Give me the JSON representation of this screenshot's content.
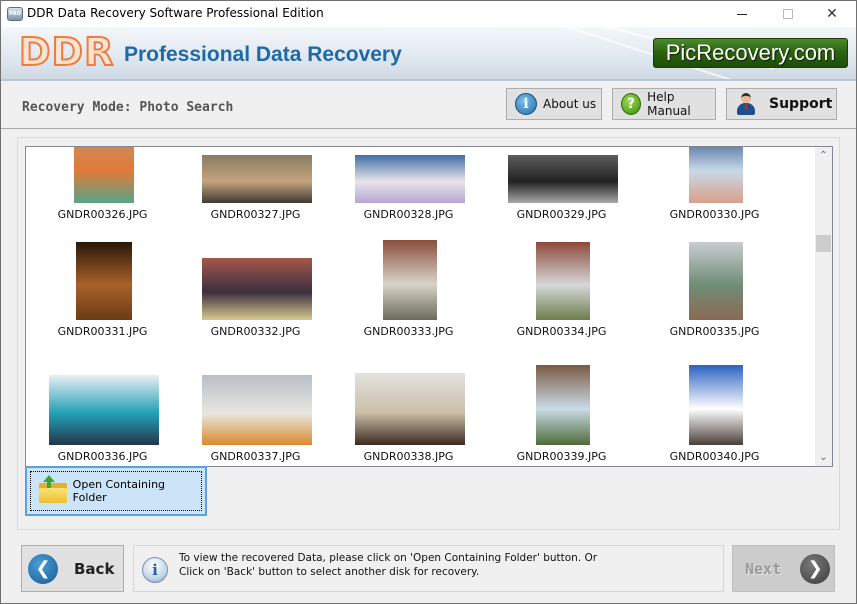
{
  "window": {
    "title": "DDR Data Recovery Software Professional Edition",
    "app_icon_label": "PRO",
    "controls": {
      "minimize": "minimize",
      "maximize": "maximize",
      "close": "✕"
    }
  },
  "banner": {
    "logo": "DDR",
    "title": "Professional Data Recovery",
    "badge": "PicRecovery.com",
    "colors": {
      "logo_orange": "#ee7c3e",
      "title_blue": "#1e6aa8",
      "badge_green": "#2c6410"
    }
  },
  "modebar": {
    "mode_text": "Recovery Mode: Photo Search",
    "buttons": [
      {
        "label": "About us",
        "icon": "info-icon"
      },
      {
        "label": "Help Manual",
        "icon": "question-icon"
      },
      {
        "label": "Support",
        "icon": "support-person-icon"
      }
    ]
  },
  "gallery": {
    "items": [
      {
        "name": "GNDR00326.JPG",
        "colors": [
          "#c99064",
          "#e07a3a",
          "#5aa58a"
        ]
      },
      {
        "name": "GNDR00327.JPG",
        "colors": [
          "#8a7b65",
          "#c4a47d",
          "#3f3a33"
        ]
      },
      {
        "name": "GNDR00328.JPG",
        "colors": [
          "#3f6fa6",
          "#e9e3ea",
          "#b6a7d3"
        ]
      },
      {
        "name": "GNDR00329.JPG",
        "colors": [
          "#5d5d5d",
          "#222222",
          "#a8a8a8"
        ]
      },
      {
        "name": "GNDR00330.JPG",
        "colors": [
          "#2d4f8a",
          "#c7d9e6",
          "#d9a08a"
        ]
      },
      {
        "name": "GNDR00331.JPG",
        "colors": [
          "#2a1608",
          "#a9622a",
          "#6b3b16"
        ]
      },
      {
        "name": "GNDR00332.JPG",
        "colors": [
          "#a4584a",
          "#3b2f3f",
          "#d9c98f"
        ]
      },
      {
        "name": "GNDR00333.JPG",
        "colors": [
          "#8a4d3b",
          "#d8d4c8",
          "#6b6b5d"
        ]
      },
      {
        "name": "GNDR00334.JPG",
        "colors": [
          "#8c4938",
          "#d6d8da",
          "#6c7d4a"
        ]
      },
      {
        "name": "GNDR00335.JPG",
        "colors": [
          "#c8cdd2",
          "#6f8d75",
          "#8b6a55"
        ]
      },
      {
        "name": "GNDR00336.JPG",
        "colors": [
          "#e9eef2",
          "#21a0b5",
          "#24364b"
        ]
      },
      {
        "name": "GNDR00337.JPG",
        "colors": [
          "#b9bfc6",
          "#e8e6e2",
          "#d98a2e"
        ]
      },
      {
        "name": "GNDR00338.JPG",
        "colors": [
          "#e3e2df",
          "#cbbfa9",
          "#3c2a20"
        ]
      },
      {
        "name": "GNDR00339.JPG",
        "colors": [
          "#7a5a45",
          "#c9dbe6",
          "#4f6a3a"
        ]
      },
      {
        "name": "GNDR00340.JPG",
        "colors": [
          "#2c62c2",
          "#ffffff",
          "#4a3f39"
        ]
      }
    ]
  },
  "actions": {
    "open_folder": "Open Containing Folder",
    "back": "Back",
    "next": "Next",
    "info_line1": "To view the recovered Data, please click on 'Open Containing Folder' button. Or",
    "info_line2": "Click on 'Back' button to select another disk for recovery."
  },
  "scroll": {
    "up": "⌃",
    "down": "⌄"
  }
}
